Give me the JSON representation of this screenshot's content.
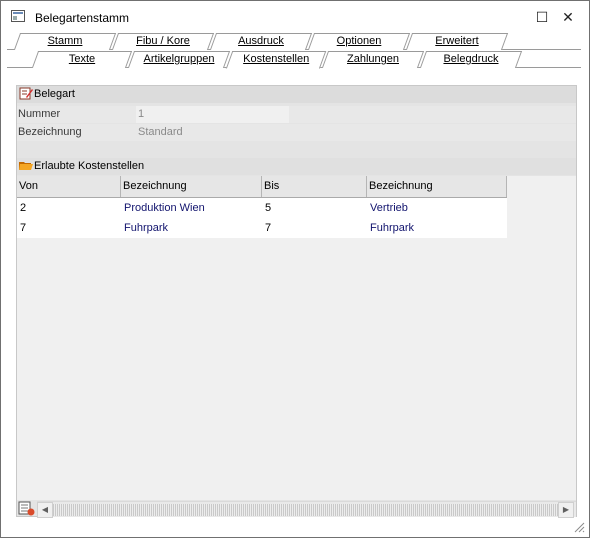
{
  "window": {
    "title": "Belegartenstamm"
  },
  "tabs_top": [
    "Stamm",
    "Fibu / Kore",
    "Ausdruck",
    "Optionen",
    "Erweitert"
  ],
  "tabs_bottom": [
    "Texte",
    "Artikelgruppen",
    "Kostenstellen",
    "Zahlungen",
    "Belegdruck"
  ],
  "active_tab": "Kostenstellen",
  "belegart": {
    "heading": "Belegart",
    "nummer_label": "Nummer",
    "nummer_value": "1",
    "bezeichnung_label": "Bezeichnung",
    "bezeichnung_value": "Standard"
  },
  "kostenstellen": {
    "heading": "Erlaubte Kostenstellen",
    "columns": [
      "Von",
      "Bezeichnung",
      "Bis",
      "Bezeichnung"
    ],
    "rows": [
      {
        "von": "2",
        "von_bez": "Produktion Wien",
        "bis": "5",
        "bis_bez": "Vertrieb"
      },
      {
        "von": "7",
        "von_bez": "Fuhrpark",
        "bis": "7",
        "bis_bez": "Fuhrpark"
      }
    ]
  },
  "colors": {
    "link": "#12146e",
    "accent_icon": "#e58a00"
  }
}
